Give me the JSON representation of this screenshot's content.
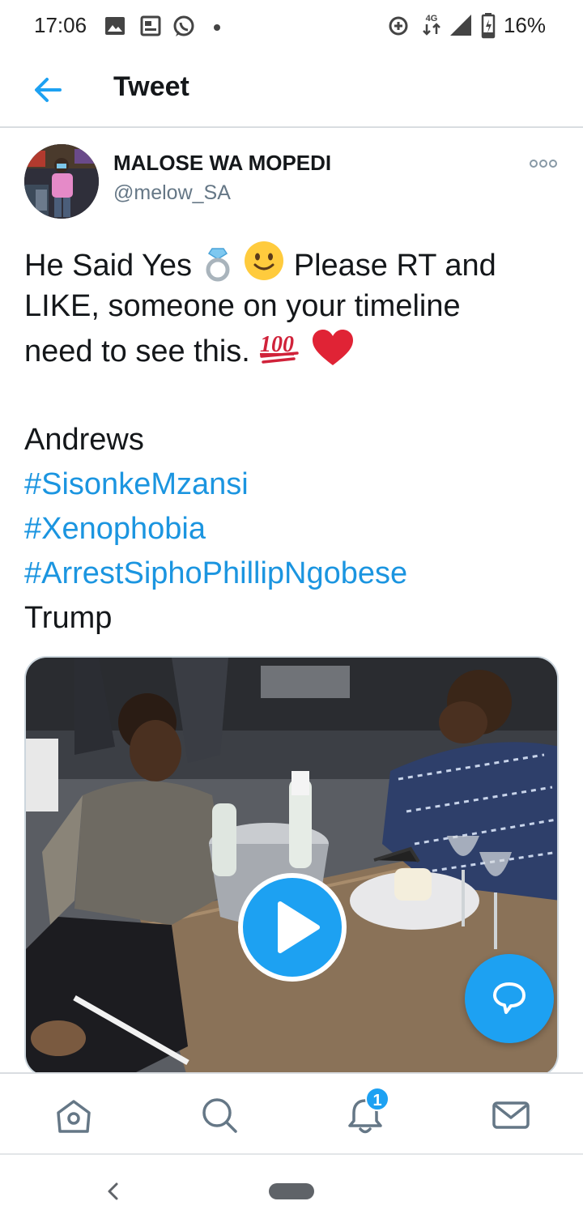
{
  "status_bar": {
    "time": "17:06",
    "network": "4G",
    "battery": "16%",
    "left_icons": [
      "gallery-icon",
      "news-icon",
      "whatsapp-icon",
      "dot-icon"
    ],
    "right_icons": [
      "data-saver-icon",
      "4g-icon",
      "signal-icon",
      "battery-icon"
    ]
  },
  "header": {
    "back_icon": "back-arrow-icon",
    "title": "Tweet"
  },
  "tweet": {
    "author_name": "MALOSE WA MOPEDI",
    "author_handle": "@melow_SA",
    "text_lines": [
      "He Said Yes",
      "Please RT and",
      "LIKE, someone on your timeline",
      "need to see this."
    ],
    "emojis": [
      "ring-emoji",
      "smile-emoji",
      "hundred-emoji",
      "heart-emoji"
    ],
    "tail_lines": [
      "Andrews",
      "Trump"
    ],
    "hashtags": [
      "#SisonkeMzansi",
      "#Xenophobia",
      "#ArrestSiphoPhillipNgobese"
    ],
    "media_type": "video"
  },
  "bottom_nav": {
    "items": [
      "home-icon",
      "search-icon",
      "notifications-icon",
      "messages-icon"
    ],
    "notification_count": "1"
  },
  "colors": {
    "accent": "#1da1f2",
    "hashtag": "#1b95e0",
    "text": "#14171a",
    "secondary": "#657786"
  }
}
